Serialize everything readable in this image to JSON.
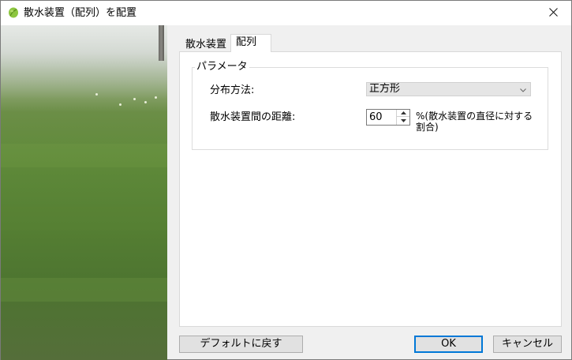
{
  "window": {
    "title": "散水装置（配列）を配置",
    "app_icon": "leaf-icon",
    "close_icon": "close-icon"
  },
  "tabs": [
    {
      "label": "散水装置",
      "selected": false
    },
    {
      "label": "配列",
      "selected": true
    }
  ],
  "parameters": {
    "group_title": "パラメータ",
    "distribution_label": "分布方法:",
    "distribution_value": "正方形",
    "spacing_label": "散水装置間の距離:",
    "spacing_value": "60",
    "spacing_unit": "%(散水装置の直径に対する割合)"
  },
  "buttons": {
    "default_label": "デフォルトに戻す",
    "ok_label": "OK",
    "cancel_label": "キャンセル"
  },
  "colors": {
    "ok_border": "#0078d7",
    "leaf_icon": "#8dc63f"
  }
}
